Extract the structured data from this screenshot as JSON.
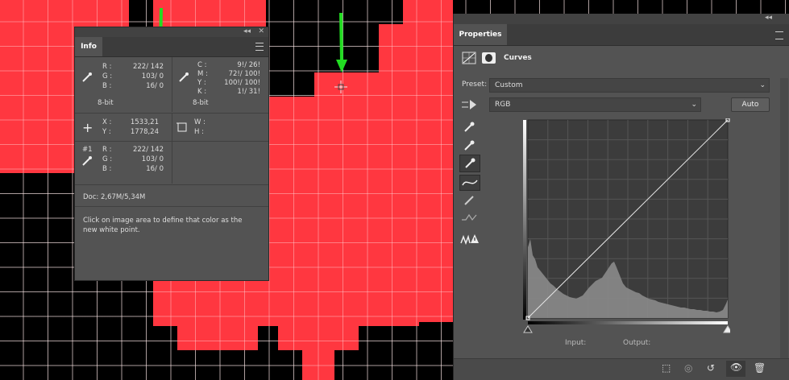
{
  "info": {
    "tab": "Info",
    "collapse_icon": "◂◂",
    "close_icon": "✕",
    "rgb_labels": [
      "R :",
      "G :",
      "B :"
    ],
    "rgb_values": [
      "222/  142",
      "103/     0",
      "16/     0"
    ],
    "cmyk_labels": [
      "C :",
      "M :",
      "Y :",
      "K :"
    ],
    "cmyk_values": [
      "9!/   26!",
      "72!/  100!",
      "100!/  100!",
      "1!/   31!"
    ],
    "bit_left": "8-bit",
    "bit_right": "8-bit",
    "xy_labels": [
      "X :",
      "Y :"
    ],
    "xy_values": [
      "1533,21",
      "1778,24"
    ],
    "wh_labels": [
      "W :",
      "H :"
    ],
    "sample_label": "#1",
    "sample_labels": [
      "R :",
      "G :",
      "B :"
    ],
    "sample_values": [
      "222/  142",
      "103/     0",
      "16/     0"
    ],
    "doc": "Doc: 2,67M/5,34M",
    "hint": "Click on image area to define that color as the new white point."
  },
  "properties": {
    "tab": "Properties",
    "collapse_icon": "◂◂",
    "adjustment": "Curves",
    "preset_label": "Preset:",
    "preset_value": "Custom",
    "channel_value": "RGB",
    "auto_button": "Auto",
    "input_label": "Input:",
    "output_label": "Output:"
  },
  "colors": {
    "red": "#ff3740",
    "arrow": "#22dd22",
    "panel": "#535353"
  }
}
